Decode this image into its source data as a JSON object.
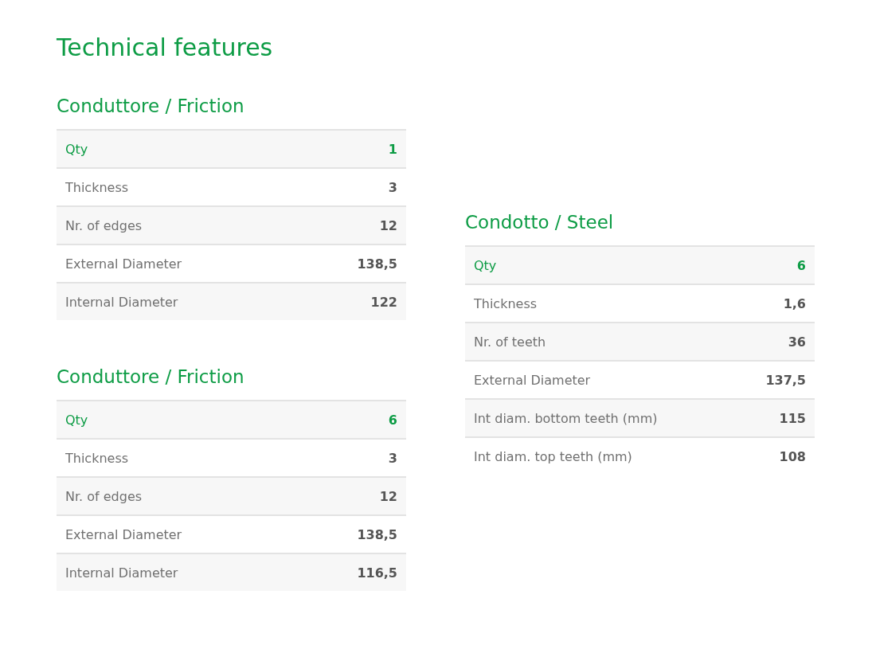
{
  "title": "Technical features",
  "columns": [
    {
      "sections": [
        {
          "heading": "Conduttore / Friction",
          "rows": [
            {
              "label": "Qty",
              "value": "1",
              "kind": "highlight"
            },
            {
              "label": "Thickness",
              "value": "3",
              "kind": "plain"
            },
            {
              "label": "Nr. of edges",
              "value": "12",
              "kind": "plain"
            },
            {
              "label": "External Diameter",
              "value": "138,5",
              "kind": "plain"
            },
            {
              "label": "Internal Diameter",
              "value": "122",
              "kind": "plain"
            }
          ]
        },
        {
          "heading": "Conduttore / Friction",
          "rows": [
            {
              "label": "Qty",
              "value": "6",
              "kind": "highlight"
            },
            {
              "label": "Thickness",
              "value": "3",
              "kind": "plain"
            },
            {
              "label": "Nr. of edges",
              "value": "12",
              "kind": "plain"
            },
            {
              "label": "External Diameter",
              "value": "138,5",
              "kind": "plain"
            },
            {
              "label": "Internal Diameter",
              "value": "116,5",
              "kind": "plain"
            }
          ]
        }
      ]
    },
    {
      "sections": [
        {
          "heading": "Condotto / Steel",
          "rows": [
            {
              "label": "Qty",
              "value": "6",
              "kind": "highlight"
            },
            {
              "label": "Thickness",
              "value": "1,6",
              "kind": "plain"
            },
            {
              "label": "Nr. of teeth",
              "value": "36",
              "kind": "plain"
            },
            {
              "label": "External Diameter",
              "value": "137,5",
              "kind": "plain"
            },
            {
              "label": "Int diam. bottom teeth (mm)",
              "value": "115",
              "kind": "plain"
            },
            {
              "label": "Int diam. top teeth (mm)",
              "value": "108",
              "kind": "plain"
            }
          ]
        }
      ]
    }
  ]
}
